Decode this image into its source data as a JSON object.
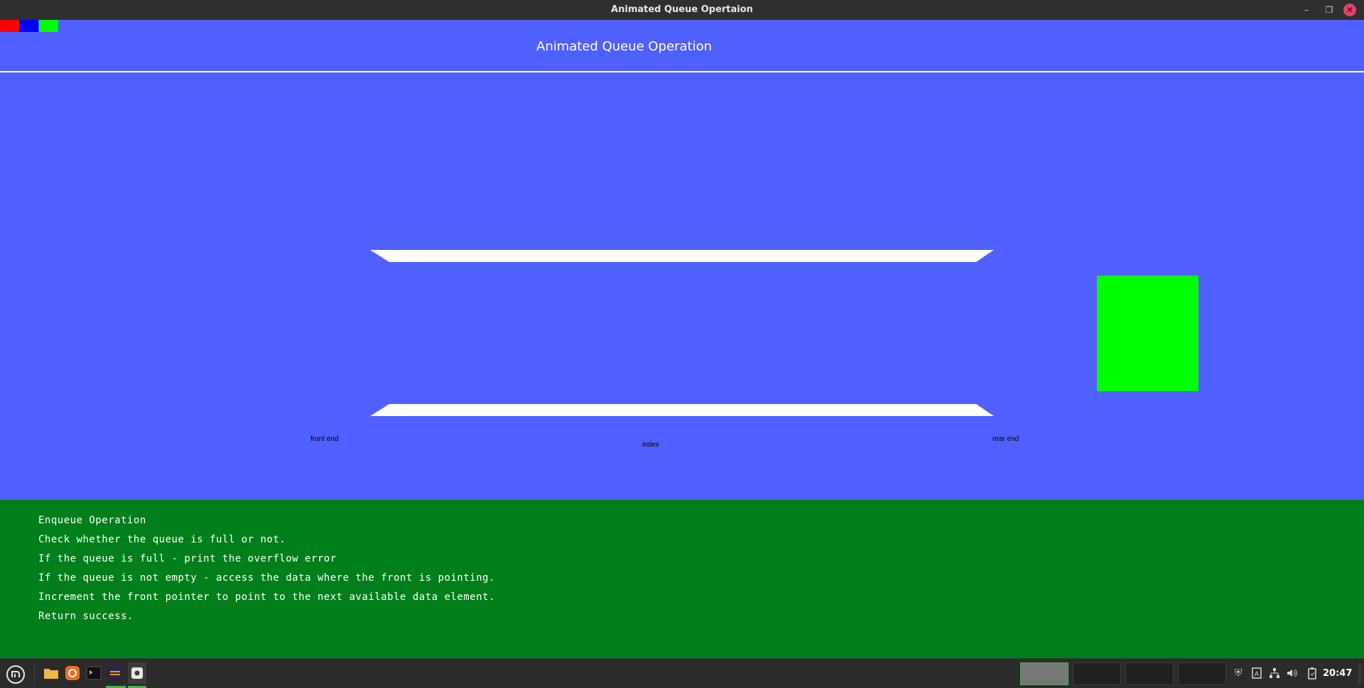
{
  "window": {
    "title": "Animated Queue Opertaion",
    "controls": [
      "minimize-icon",
      "maximize-icon",
      "close-icon"
    ]
  },
  "app": {
    "color_swatches": [
      "#ff0000",
      "#0000ff",
      "#00ff00"
    ],
    "heading": "Animated Queue Operation",
    "background_color": "#5060ff",
    "queue": {
      "front_label": "front end",
      "index_label": "index",
      "rear_label": "rear end",
      "rail_color": "#ffffff",
      "incoming_block_color": "#00ff00"
    },
    "instructions": {
      "background_color": "#007f1a",
      "lines": [
        "Enqueue Operation",
        "Check whether the queue is full or not.",
        "If the queue is full - print the overflow error",
        "If the queue is not empty - access the data where the front is pointing.",
        "Increment the front pointer to point to the next available data element.",
        "Return success."
      ]
    }
  },
  "taskbar": {
    "apps": [
      "mint-menu-icon",
      "files-icon",
      "firefox-icon",
      "terminal-icon",
      "eclipse-icon",
      "settings-icon"
    ],
    "workspaces": 4,
    "active_workspace": 1,
    "tray": [
      "shield-icon",
      "keyboard-icon",
      "network-icon",
      "volume-icon",
      "battery-icon"
    ],
    "clock": "20:47"
  }
}
